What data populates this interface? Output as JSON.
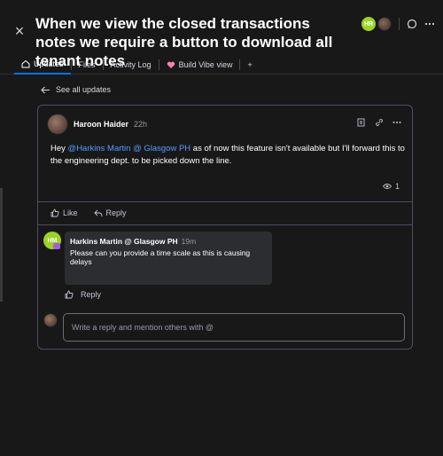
{
  "header": {
    "close_icon": "×",
    "title": "When we view the closed transactions notes we require a button to download all tenant notes",
    "avatar_initials": "HR"
  },
  "tabs": [
    {
      "label": "Updates",
      "icon": "home-icon",
      "active": true
    },
    {
      "label": "Files"
    },
    {
      "label": "Activity Log"
    },
    {
      "label": "Build Vibe view",
      "icon": "heart-icon"
    },
    {
      "label": "+"
    }
  ],
  "nav": {
    "see_all_label": "See all updates"
  },
  "post": {
    "author": "Haroon Haider",
    "time": "22h",
    "body_prefix": "Hey ",
    "mention": "@Harkins Martin @ Glasgow PH",
    "body_suffix": " as of now this feature isn't available but I'll forward this to the engineering dept. to be picked down the line.",
    "views": "1",
    "like_label": "Like",
    "reply_label": "Reply"
  },
  "reply": {
    "avatar_initials": "HM",
    "author": "Harkins Martin @ Glasgow PH",
    "time": "19m",
    "text": "Please can you provide a time scale as this is causing delays",
    "reply_label": "Reply"
  },
  "composer": {
    "placeholder": "Write a reply and mention others with @"
  },
  "colors": {
    "accent": "#0073ea",
    "mention": "#579bfc",
    "avatar_green": "#9cd326"
  }
}
